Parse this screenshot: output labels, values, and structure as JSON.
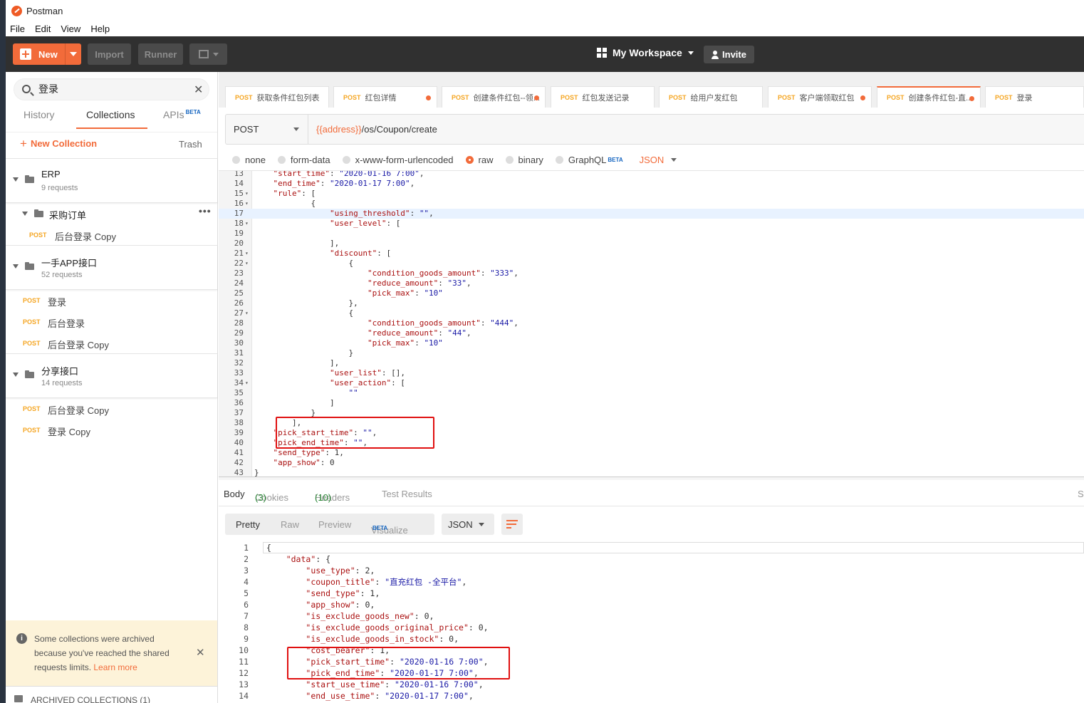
{
  "window": {
    "title": "Postman"
  },
  "menu": [
    "File",
    "Edit",
    "View",
    "Help"
  ],
  "toolbar": {
    "new_label": "New",
    "import_label": "Import",
    "runner_label": "Runner",
    "workspace_label": "My Workspace",
    "invite_label": "Invite"
  },
  "sidebar": {
    "search_value": "登录",
    "tabs": {
      "history": "History",
      "collections": "Collections",
      "apis": "APIs",
      "apis_badge": "BETA"
    },
    "new_collection": "New Collection",
    "trash": "Trash",
    "collections": [
      {
        "name": "ERP",
        "count": "9 requests"
      },
      {
        "name": "一手APP接口",
        "count": "52 requests"
      },
      {
        "name": "分享接口",
        "count": "14 requests"
      }
    ],
    "erp_folder": "采购订单",
    "erp_folder_requests": [
      {
        "method": "POST",
        "name": "后台登录 Copy"
      }
    ],
    "app_requests": [
      {
        "method": "POST",
        "name": "登录"
      },
      {
        "method": "POST",
        "name": "后台登录"
      },
      {
        "method": "POST",
        "name": "后台登录 Copy"
      }
    ],
    "share_requests": [
      {
        "method": "POST",
        "name": "后台登录 Copy"
      },
      {
        "method": "POST",
        "name": "登录 Copy"
      }
    ],
    "archived_note": "Some collections were archived because you've reached the shared requests limits.",
    "learn_more": "Learn more",
    "archived_collections": "ARCHIVED COLLECTIONS (1)"
  },
  "request_tabs": [
    {
      "method": "POST",
      "name": "获取条件红包列表",
      "dirty": false
    },
    {
      "method": "POST",
      "name": "红包详情",
      "dirty": true
    },
    {
      "method": "POST",
      "name": "创建条件红包--领...",
      "dirty": true
    },
    {
      "method": "POST",
      "name": "红包发送记录",
      "dirty": false
    },
    {
      "method": "POST",
      "name": "给用户发红包",
      "dirty": false
    },
    {
      "method": "POST",
      "name": "客户端领取红包",
      "dirty": true
    },
    {
      "method": "POST",
      "name": "创建条件红包-直...",
      "dirty": true,
      "active": true
    },
    {
      "method": "POST",
      "name": "登录",
      "dirty": false
    }
  ],
  "request": {
    "method": "POST",
    "url_var": "{{address}}",
    "url_path": "/os/Coupon/create",
    "body_types": [
      "none",
      "form-data",
      "x-www-form-urlencoded",
      "raw",
      "binary",
      "GraphQL"
    ],
    "selected_body_type": "raw",
    "graphql_badge": "BETA",
    "format": "JSON"
  },
  "request_body_lines": [
    {
      "n": "13",
      "fold": false,
      "code": "    \"start_time\": \"2020-01-16 7:00\","
    },
    {
      "n": "14",
      "fold": false,
      "code": "    \"end_time\": \"2020-01-17 7:00\","
    },
    {
      "n": "15",
      "fold": true,
      "code": "    \"rule\": ["
    },
    {
      "n": "16",
      "fold": true,
      "code": "            {"
    },
    {
      "n": "17",
      "fold": false,
      "code": "                \"using_threshold\": \"\",",
      "active": true
    },
    {
      "n": "18",
      "fold": true,
      "code": "                \"user_level\": ["
    },
    {
      "n": "19",
      "fold": false,
      "code": ""
    },
    {
      "n": "20",
      "fold": false,
      "code": "                ],"
    },
    {
      "n": "21",
      "fold": true,
      "code": "                \"discount\": ["
    },
    {
      "n": "22",
      "fold": true,
      "code": "                    {"
    },
    {
      "n": "23",
      "fold": false,
      "code": "                        \"condition_goods_amount\": \"333\","
    },
    {
      "n": "24",
      "fold": false,
      "code": "                        \"reduce_amount\": \"33\","
    },
    {
      "n": "25",
      "fold": false,
      "code": "                        \"pick_max\": \"10\""
    },
    {
      "n": "26",
      "fold": false,
      "code": "                    },"
    },
    {
      "n": "27",
      "fold": true,
      "code": "                    {"
    },
    {
      "n": "28",
      "fold": false,
      "code": "                        \"condition_goods_amount\": \"444\","
    },
    {
      "n": "29",
      "fold": false,
      "code": "                        \"reduce_amount\": \"44\","
    },
    {
      "n": "30",
      "fold": false,
      "code": "                        \"pick_max\": \"10\""
    },
    {
      "n": "31",
      "fold": false,
      "code": "                    }"
    },
    {
      "n": "32",
      "fold": false,
      "code": "                ],"
    },
    {
      "n": "33",
      "fold": false,
      "code": "                \"user_list\": [],"
    },
    {
      "n": "34",
      "fold": true,
      "code": "                \"user_action\": ["
    },
    {
      "n": "35",
      "fold": false,
      "code": "                    \"\""
    },
    {
      "n": "36",
      "fold": false,
      "code": "                ]"
    },
    {
      "n": "37",
      "fold": false,
      "code": "            }"
    },
    {
      "n": "38",
      "fold": false,
      "code": "        ],"
    },
    {
      "n": "39",
      "fold": false,
      "code": "    \"pick_start_time\": \"\","
    },
    {
      "n": "40",
      "fold": false,
      "code": "    \"pick_end_time\": \"\","
    },
    {
      "n": "41",
      "fold": false,
      "code": "    \"send_type\": 1,"
    },
    {
      "n": "42",
      "fold": false,
      "code": "    \"app_show\": 0"
    },
    {
      "n": "43",
      "fold": false,
      "code": "}"
    }
  ],
  "response": {
    "tabs": {
      "body": "Body",
      "cookies": "Cookies",
      "cookies_count": "(3)",
      "headers": "Headers",
      "headers_count": "(10)",
      "tests": "Test Results",
      "status": "St"
    },
    "view_modes": {
      "pretty": "Pretty",
      "raw": "Raw",
      "preview": "Preview",
      "visualize": "Visualize",
      "visualize_badge": "BETA",
      "format": "JSON"
    }
  },
  "response_body_lines": [
    {
      "n": "1",
      "code": "{"
    },
    {
      "n": "2",
      "code": "    \"data\": {"
    },
    {
      "n": "3",
      "code": "        \"use_type\": 2,"
    },
    {
      "n": "4",
      "code": "        \"coupon_title\": \"直充红包 -全平台\","
    },
    {
      "n": "5",
      "code": "        \"send_type\": 1,"
    },
    {
      "n": "6",
      "code": "        \"app_show\": 0,"
    },
    {
      "n": "7",
      "code": "        \"is_exclude_goods_new\": 0,"
    },
    {
      "n": "8",
      "code": "        \"is_exclude_goods_original_price\": 0,"
    },
    {
      "n": "9",
      "code": "        \"is_exclude_goods_in_stock\": 0,"
    },
    {
      "n": "10",
      "code": "        \"cost_bearer\": 1,"
    },
    {
      "n": "11",
      "code": "        \"pick_start_time\": \"2020-01-16 7:00\","
    },
    {
      "n": "12",
      "code": "        \"pick_end_time\": \"2020-01-17 7:00\","
    },
    {
      "n": "13",
      "code": "        \"start_use_time\": \"2020-01-16 7:00\","
    },
    {
      "n": "14",
      "code": "        \"end_use_time\": \"2020-01-17 7:00\","
    }
  ],
  "colors": {
    "accent": "#f26b3a",
    "method_post": "#f5a623",
    "toolbar_bg": "#303030",
    "highlight_box": "#e01010"
  }
}
